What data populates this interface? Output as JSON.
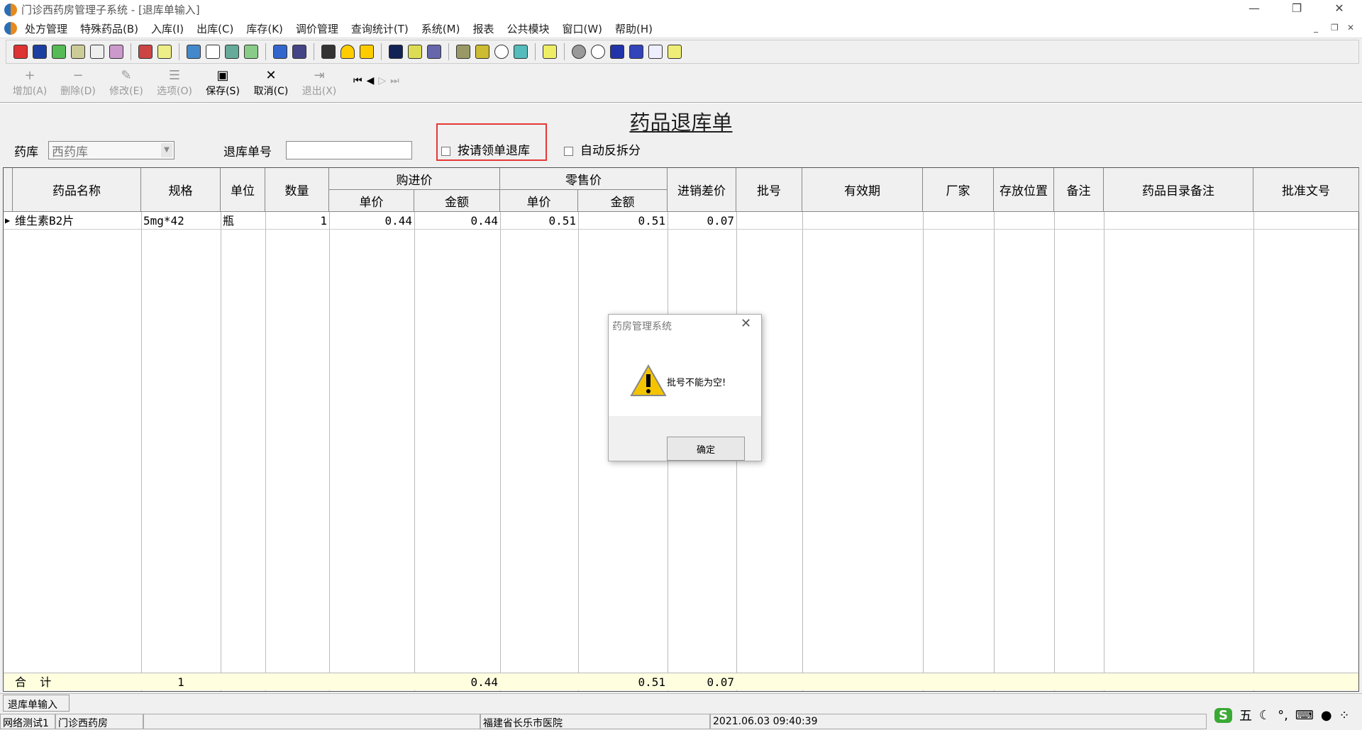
{
  "window": {
    "title": "门诊西药房管理子系统 - [退库单输入]"
  },
  "menu": [
    "处方管理",
    "特殊药品(B)",
    "入库(I)",
    "出库(C)",
    "库存(K)",
    "调价管理",
    "查询统计(T)",
    "系统(M)",
    "报表",
    "公共模块",
    "窗口(W)",
    "帮助(H)"
  ],
  "toolbar2": [
    {
      "label": "增加(A)",
      "icon": "add-icon",
      "glyph": "+",
      "enabled": false
    },
    {
      "label": "删除(D)",
      "icon": "delete-icon",
      "glyph": "−",
      "enabled": false
    },
    {
      "label": "修改(E)",
      "icon": "edit-icon",
      "glyph": "✎",
      "enabled": false
    },
    {
      "label": "选项(O)",
      "icon": "options-icon",
      "glyph": "☰",
      "enabled": false
    },
    {
      "label": "保存(S)",
      "icon": "save-icon",
      "glyph": "▣",
      "enabled": true
    },
    {
      "label": "取消(C)",
      "icon": "cancel-icon",
      "glyph": "✕",
      "enabled": true
    },
    {
      "label": "退出(X)",
      "icon": "exit-icon",
      "glyph": "⇥",
      "enabled": false
    }
  ],
  "form": {
    "title": "药品退库单",
    "pharmacy_label": "药库",
    "pharmacy_value": "西药库",
    "return_no_label": "退库单号",
    "return_no_value": "",
    "by_requisition_label": "按请领单退库",
    "auto_split_label": "自动反拆分"
  },
  "grid": {
    "headers": {
      "name": "药品名称",
      "spec": "规格",
      "unit": "单位",
      "qty": "数量",
      "purchase": "购进价",
      "retail": "零售价",
      "unit_price": "单价",
      "amount": "金额",
      "diff": "进销差价",
      "batch": "批号",
      "expiry": "有效期",
      "maker": "厂家",
      "location": "存放位置",
      "remark": "备注",
      "catalog_remark": "药品目录备注",
      "approval": "批准文号"
    },
    "rows": [
      {
        "name": "维生素B2片",
        "spec": "5mg*42",
        "unit": "瓶",
        "qty": "1",
        "p_price": "0.44",
        "p_amount": "0.44",
        "r_price": "0.51",
        "r_amount": "0.51",
        "diff": "0.07"
      }
    ],
    "total": {
      "label": "合  计",
      "qty": "1",
      "p_amount": "0.44",
      "r_amount": "0.51",
      "diff": "0.07"
    }
  },
  "dialog": {
    "title": "药房管理系统",
    "message": "批号不能为空!",
    "ok": "确定"
  },
  "tab": "退库单输入",
  "status": {
    "user": "网络测试1",
    "dept": "门诊西药房",
    "hospital": "福建省长乐市医院",
    "datetime": "2021.06.03 09:40:39"
  },
  "ime": {
    "mode": "五"
  }
}
